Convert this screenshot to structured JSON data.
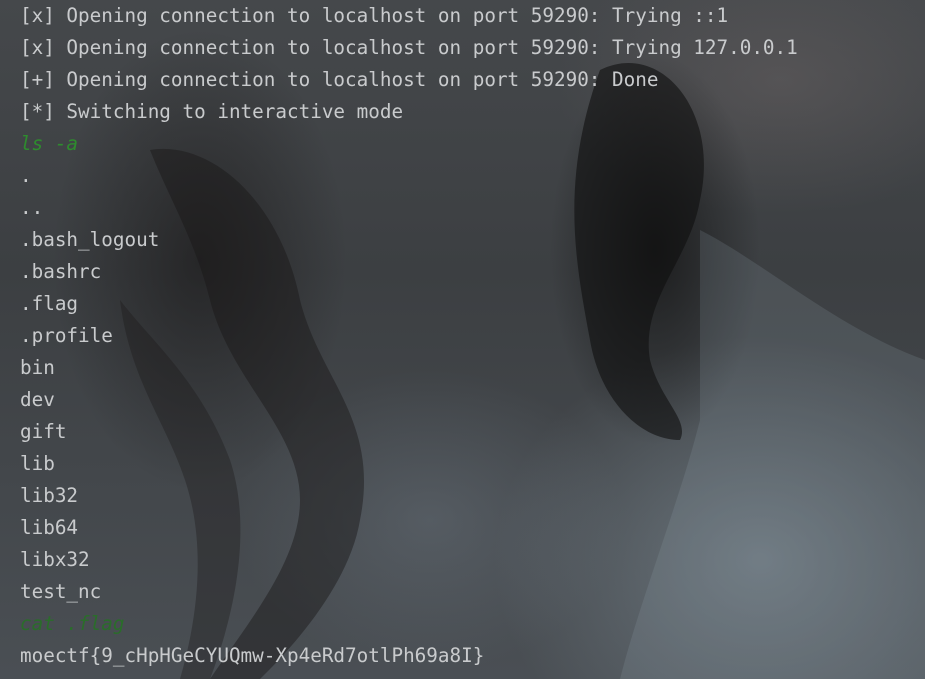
{
  "terminal": {
    "lines": [
      {
        "text": "[x] Opening connection to localhost on port 59290: Trying ::1",
        "kind": "status"
      },
      {
        "text": "[x] Opening connection to localhost on port 59290: Trying 127.0.0.1",
        "kind": "status"
      },
      {
        "text": "[+] Opening connection to localhost on port 59290: Done",
        "kind": "status"
      },
      {
        "text": "[*] Switching to interactive mode",
        "kind": "status"
      },
      {
        "text": "ls -a",
        "kind": "command"
      },
      {
        "text": ".",
        "kind": "output"
      },
      {
        "text": "..",
        "kind": "output"
      },
      {
        "text": ".bash_logout",
        "kind": "output"
      },
      {
        "text": ".bashrc",
        "kind": "output"
      },
      {
        "text": ".flag",
        "kind": "output"
      },
      {
        "text": ".profile",
        "kind": "output"
      },
      {
        "text": "bin",
        "kind": "output"
      },
      {
        "text": "dev",
        "kind": "output"
      },
      {
        "text": "gift",
        "kind": "output"
      },
      {
        "text": "lib",
        "kind": "output"
      },
      {
        "text": "lib32",
        "kind": "output"
      },
      {
        "text": "lib64",
        "kind": "output"
      },
      {
        "text": "libx32",
        "kind": "output"
      },
      {
        "text": "test_nc",
        "kind": "output"
      },
      {
        "text": "cat .flag",
        "kind": "command"
      },
      {
        "text": "moectf{9_cHpHGeCYUQmw-Xp4eRd7otlPh69a8I}",
        "kind": "output"
      }
    ]
  },
  "colors": {
    "output_text": "#c9cbcd",
    "command_text": "#2e8b2e",
    "background": "#3a3d40"
  }
}
